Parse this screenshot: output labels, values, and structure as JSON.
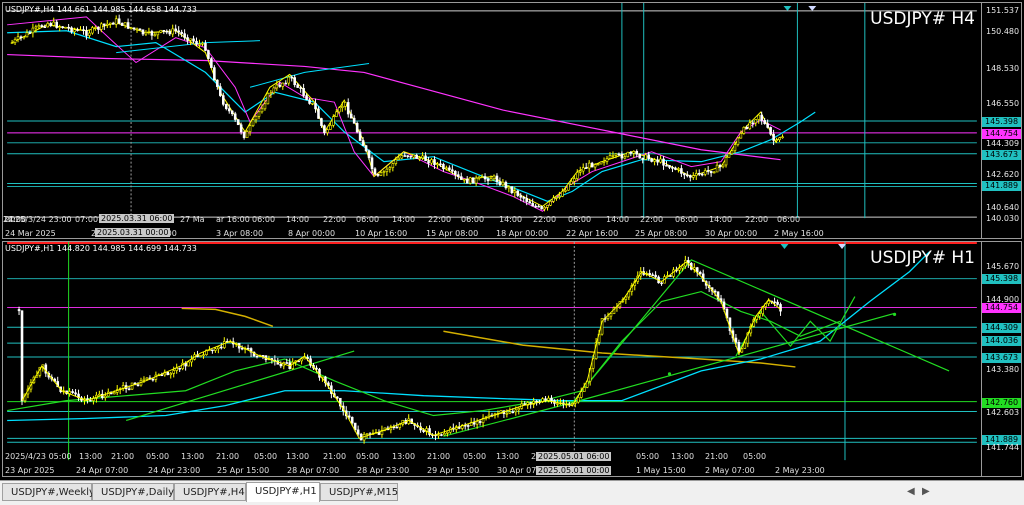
{
  "top": {
    "header": "USDJPY#,H4  144.661 144.985 144.658 144.733",
    "title": "USDJPY# H4",
    "price_labels": [
      "151.537",
      "150.480",
      "148.530",
      "146.550",
      "145.398",
      "144.754",
      "144.309",
      "143.673",
      "142.620",
      "141.889",
      "140.640",
      "140.030"
    ],
    "x_labels": [
      "2025/3/24 23:00",
      "07:00",
      "27 Ma",
      "ar 16:00",
      "06:00",
      "14:00",
      "22:00",
      "06:00",
      "14:00",
      "22:00",
      "06:00",
      "14:00",
      "22:00",
      "06:00",
      "14:00",
      "22:00",
      "06:00",
      "14:00",
      "22:00",
      "06:00",
      "14:00",
      "22:00"
    ],
    "date_labels": [
      "24 Mar 2025",
      "27 Ma",
      "ar 16:00",
      "3 Apr 08:00",
      "8 Apr 00:00",
      "10 Apr 16:00",
      "15 Apr 08:00",
      "18 Apr 00:00",
      "22 Apr 16:00",
      "25 Apr 08:00",
      "30 Apr 00:00",
      "2 May 16:00"
    ],
    "cursor_labels": [
      "2025.03.31 06:00",
      "2025.03.31 00:00"
    ]
  },
  "bottom": {
    "header": "USDJPY#,H1  144.820 144.985 144.699 144.733",
    "title": "USDJPY# H1",
    "price_labels": [
      "145.670",
      "145.398",
      "144.900",
      "144.754",
      "144.309",
      "144.036",
      "143.673",
      "143.380",
      "142.760",
      "142.603",
      "141.889",
      "141.744"
    ],
    "time_labels": [
      "2025/4/23 05:00",
      "13:00",
      "21:00",
      "05:00",
      "13:00",
      "21:00",
      "05:00",
      "13:00",
      "21:00",
      "05:00",
      "13:00",
      "21:00",
      "05:00",
      "13:00",
      "21:00",
      "05:00",
      "13:00",
      "21:00",
      "05:00"
    ],
    "date_labels": [
      "23 Apr 2025",
      "24 Apr 07:00",
      "24 Apr 23:00",
      "25 Apr 15:00",
      "28 Apr 07:00",
      "28 Apr 23:00",
      "29 Apr 15:00",
      "30 Apr 07:00",
      "1 May 15:00",
      "2 May 07:00",
      "2 May 23:00"
    ],
    "cursor_labels": [
      "2025.05.01 06:00",
      "2025.05.01 00:00"
    ]
  },
  "tabs": [
    "USDJPY#,Weekly",
    "USDJPY#,Daily",
    "USDJPY#,H4",
    "USDJPY#,H1",
    "USDJPY#,M15"
  ],
  "active_tab": "USDJPY#,H1",
  "colors": {
    "up": "#ffff00",
    "down": "#ffffff",
    "cyan": "#00e0ff",
    "magenta": "#ff33ff",
    "green": "#22dd22",
    "teal": "#20c0c0",
    "orange": "#d4b000",
    "red": "#ff2020",
    "ask": "#ff33ff",
    "fill_green": "#22dd22"
  }
}
